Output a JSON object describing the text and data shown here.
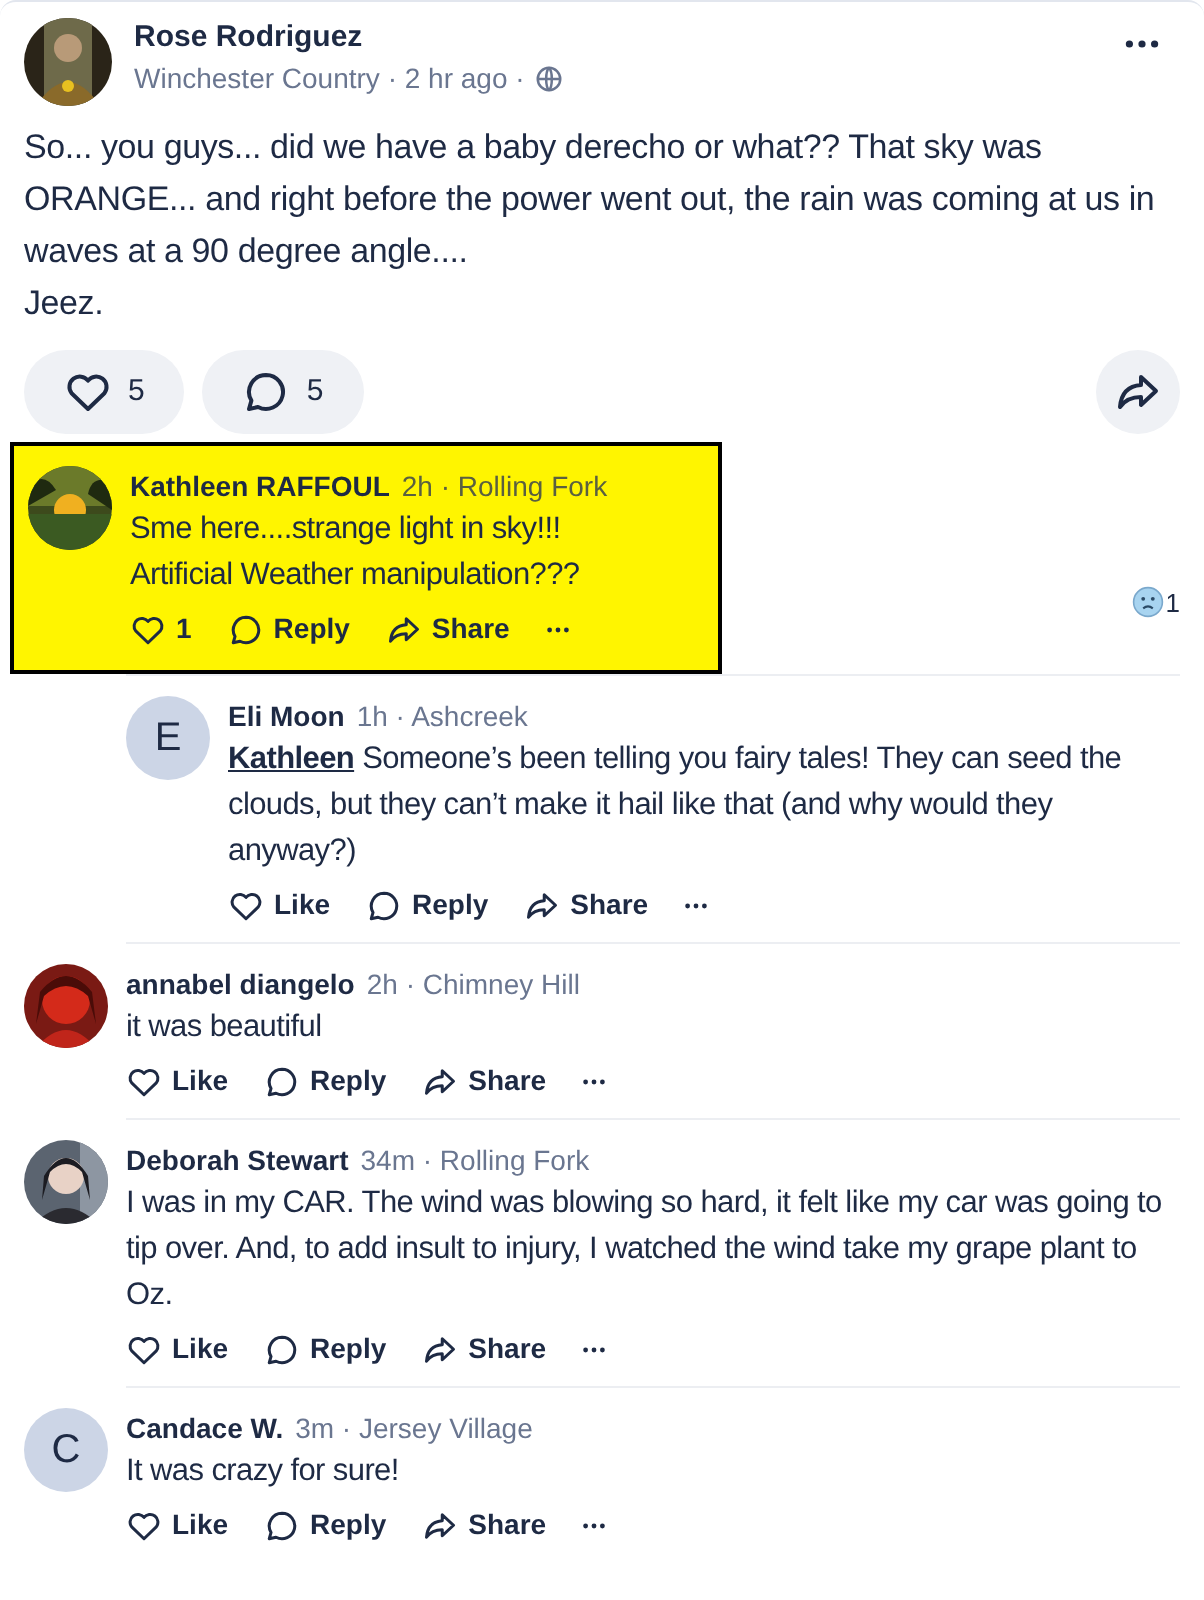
{
  "post": {
    "author": "Rose Rodriguez",
    "meta": "Winchester Country · 2 hr ago ·",
    "text": "So... you guys... did we have a baby derecho or what?? That sky was ORANGE... and right before the power went out, the rain was coming at us in waves at a 90 degree angle....\nJeez.",
    "like_count": "5",
    "comment_count": "5"
  },
  "comments": [
    {
      "author": "Kathleen RAFFOUL",
      "meta": "2h · Rolling Fork",
      "text": "Sme here....strange light in sky!!!\nArtificial Weather manipulation???",
      "like_label": "1",
      "reply_label": "Reply",
      "share_label": "Share",
      "highlighted": true,
      "reaction_count": "1",
      "replies": [
        {
          "author": "Eli Moon",
          "meta": "1h · Ashcreek",
          "avatar": {
            "kind": "initial",
            "letter": "E"
          },
          "mention": "Kathleen",
          "text": "Someone’s been telling you fairy tales! They can seed the clouds, but they can’t make it hail like that (and why would they anyway?)",
          "like_label": "Like",
          "reply_label": "Reply",
          "share_label": "Share",
          "highlighted": false
        }
      ]
    },
    {
      "author": "annabel diangelo",
      "meta": "2h · Chimney Hill",
      "text": "it was beautiful",
      "like_label": "Like",
      "reply_label": "Reply",
      "share_label": "Share",
      "highlighted": false
    },
    {
      "author": "Deborah Stewart",
      "meta": "34m · Rolling Fork",
      "text": "I was in my CAR. The wind was blowing so hard, it felt like my car was going to tip over. And, to add insult to injury, I watched the wind take my grape plant to Oz.",
      "like_label": "Like",
      "reply_label": "Reply",
      "share_label": "Share",
      "highlighted": false
    },
    {
      "author": "Candace W.",
      "meta": "3m · Jersey Village",
      "avatar": {
        "kind": "initial",
        "letter": "C"
      },
      "text": "It was crazy for sure!",
      "like_label": "Like",
      "reply_label": "Reply",
      "share_label": "Share",
      "highlighted": false
    }
  ]
}
